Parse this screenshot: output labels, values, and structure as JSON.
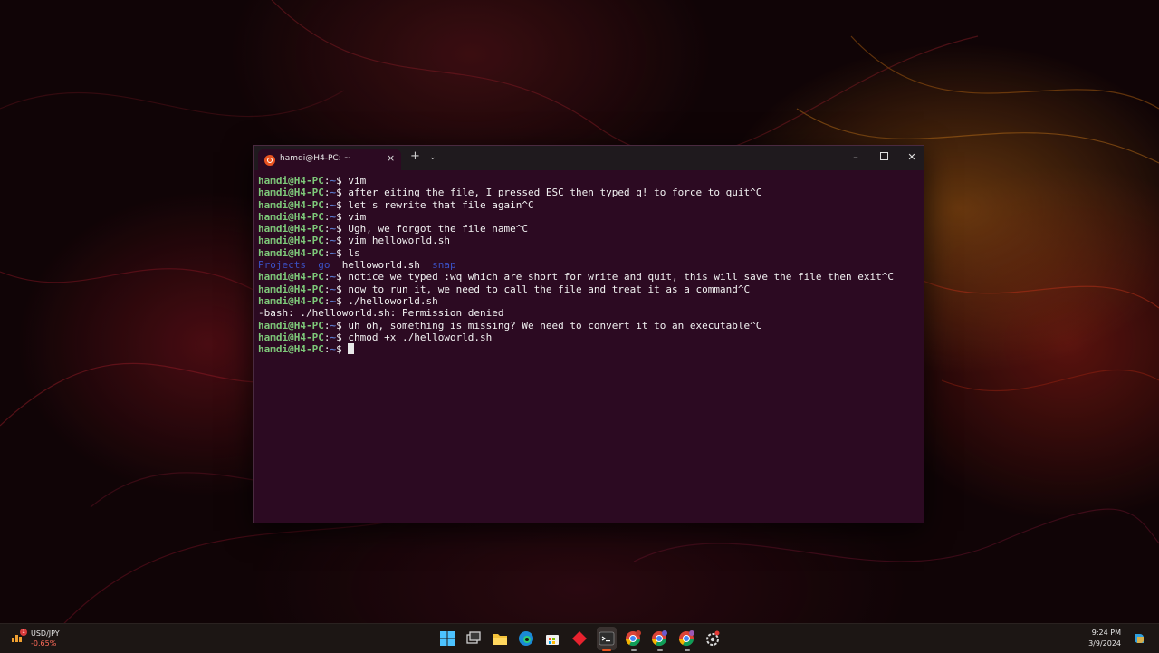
{
  "terminal": {
    "tab_title": "hamdi@H4-PC: ~",
    "close_glyph": "×",
    "new_tab_glyph": "+",
    "dropdown_glyph": "⌄",
    "minimize_glyph": "–",
    "close_window_glyph": "✕",
    "prompt_user": "hamdi@H4-PC",
    "prompt_sep": ":",
    "prompt_path": "~",
    "prompt_symbol": "$ ",
    "commands": [
      "vim",
      "after eiting the file, I pressed ESC then typed q! to force to quit^C",
      "let's rewrite that file again^C",
      "vim",
      "Ugh, we forgot the file name^C",
      "vim helloworld.sh",
      "ls"
    ],
    "ls_output": {
      "dirs_before": [
        "Projects",
        "go"
      ],
      "file": "helloworld.sh",
      "dirs_after": [
        "snap"
      ]
    },
    "commands_after_ls": [
      "notice we typed :wq which are short for write and quit, this will save the file then exit^C",
      "now to run it, we need to call the file and treat it as a command^C",
      "./helloworld.sh"
    ],
    "error_line": "-bash: ./helloworld.sh: Permission denied",
    "commands_final": [
      "uh oh, something is missing? We need to convert it to an executable^C",
      "chmod +x ./helloworld.sh"
    ],
    "colors": {
      "background": "#2c0a22",
      "prompt_user": "#7ec97a",
      "prompt_path": "#5a78c8",
      "directory": "#3b50c4",
      "accent": "#e95420"
    }
  },
  "taskbar": {
    "widget": {
      "name": "USD/JPY",
      "change": "-0.65%",
      "badge": "1",
      "icon": "stock-chart-icon"
    },
    "icons": [
      "windows-start-icon",
      "task-view-icon",
      "file-explorer-icon",
      "edge-browser-icon",
      "microsoft-store-icon",
      "red-diamond-app-icon",
      "terminal-icon",
      "chrome-profile-h-icon",
      "chrome-profile-h2-icon",
      "chrome-profile-p-icon",
      "settings-gear-icon"
    ],
    "clock": {
      "time": "9:24 PM",
      "date": "3/9/2024"
    },
    "copilot_icon": "copilot-icon"
  }
}
